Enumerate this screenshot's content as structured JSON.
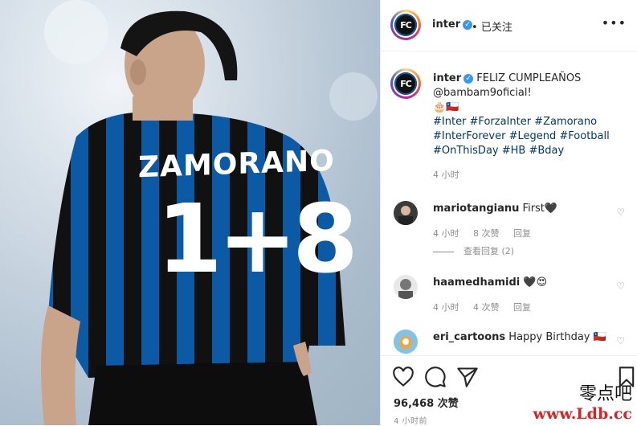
{
  "post_image": {
    "shirt_name": "ZAMORANO",
    "shirt_number": "1+8"
  },
  "header": {
    "username": "inter",
    "verified_icon": "verified-badge-icon",
    "separator": "•",
    "follow_state": "已关注",
    "more_icon": "more-options-icon"
  },
  "caption": {
    "username": "inter",
    "line1": "FELIZ CUMPLEAÑOS",
    "line2": "@bambam9oficial!",
    "line3": "🎂🇨🇱",
    "hashtags_line1": "#Inter #ForzaInter #Zamorano",
    "hashtags_line2": "#InterForever #Legend #Football",
    "hashtags_line3": "#OnThisDay #HB #Bday",
    "time": "4 小时"
  },
  "comments": [
    {
      "username": "mariotangianu",
      "text": "First🖤",
      "time": "4 小时",
      "likes": "8 次赞",
      "reply": "回复",
      "view_replies": "查看回复 (2)"
    },
    {
      "username": "haamedhamidi",
      "text": "🖤😍",
      "time": "4 小时",
      "likes": "4 次赞",
      "reply": "回复"
    },
    {
      "username": "eri_cartoons",
      "text": "Happy Birthday 🇨🇱"
    }
  ],
  "actions": {
    "like_icon": "heart-icon",
    "comment_icon": "comment-icon",
    "share_icon": "share-icon",
    "save_icon": "bookmark-icon",
    "likes_count": "96,468 次赞",
    "posted_ago": "4 小时前"
  },
  "watermark": {
    "line1": "零点吧",
    "line2": "www.Ldb.cc"
  },
  "colors": {
    "inter_blue": "#0c5aa6",
    "jersey_black": "#111111",
    "hashtag": "#00376b",
    "muted": "#8e8e8e",
    "verified": "#3897f0",
    "watermark_red": "#e02020"
  }
}
